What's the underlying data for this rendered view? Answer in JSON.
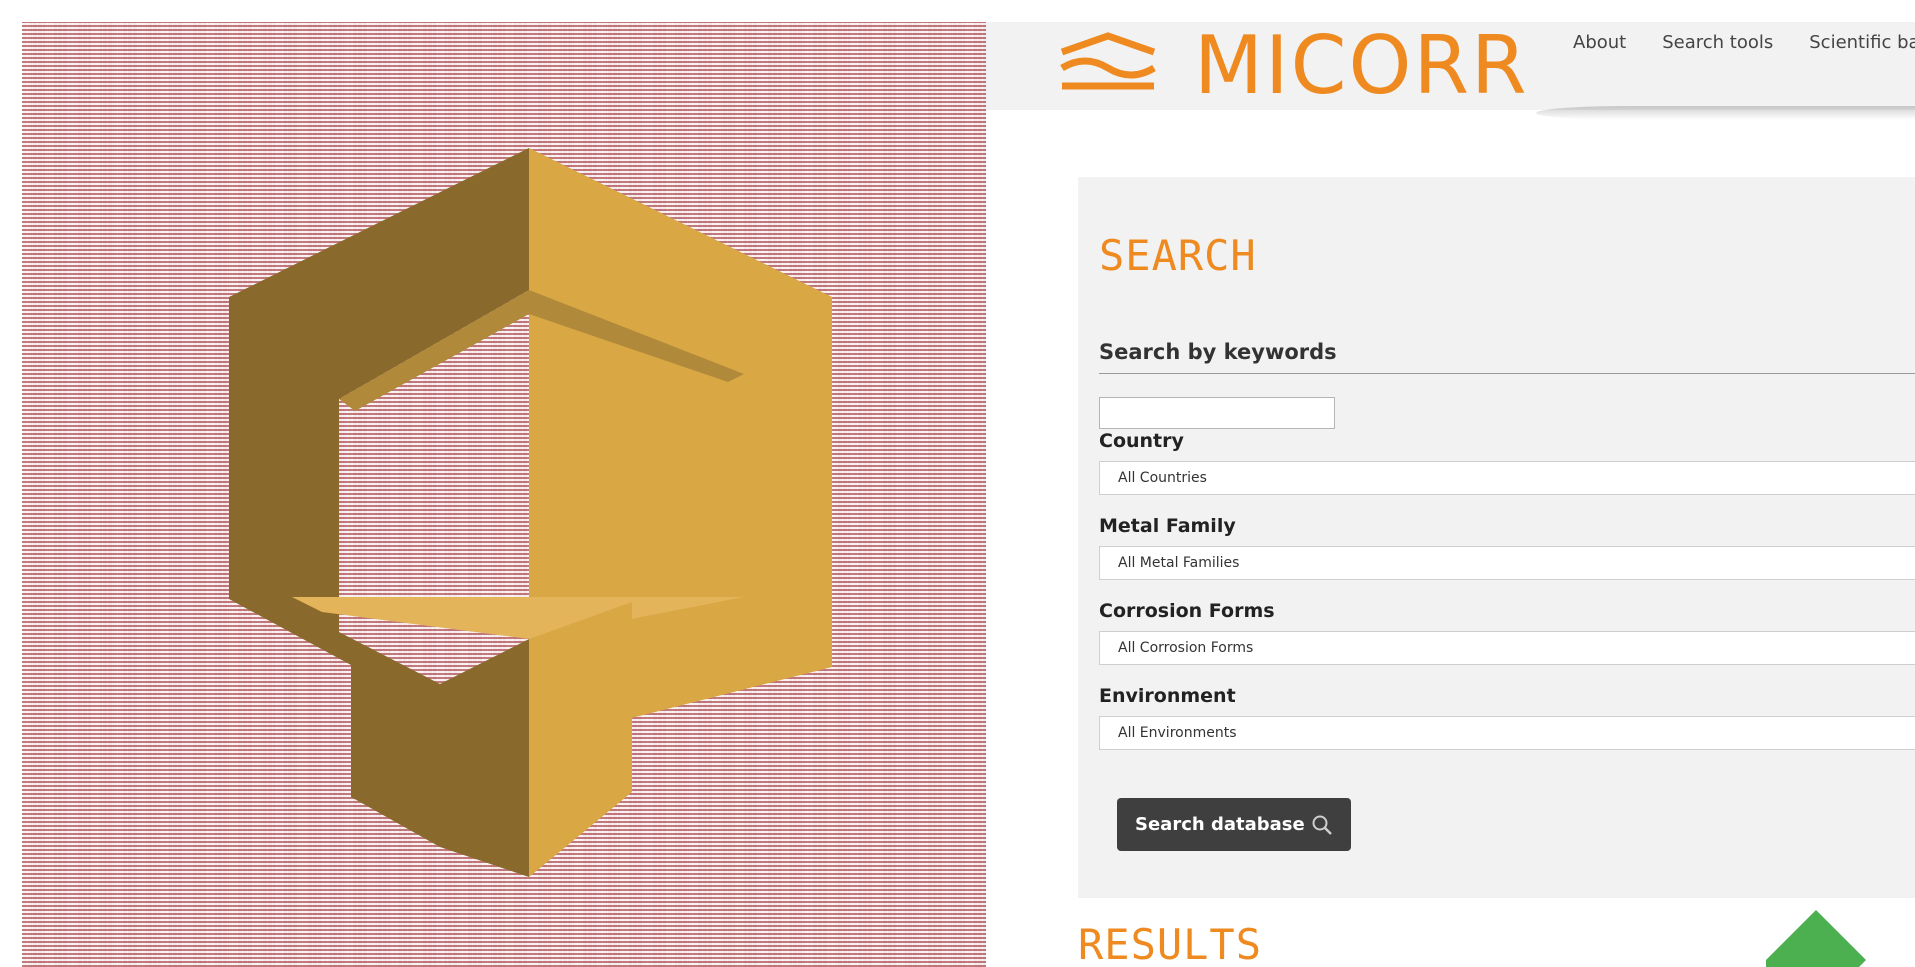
{
  "brand": {
    "name": "MICORR",
    "color": "#ee8a20"
  },
  "nav": [
    {
      "label": "About"
    },
    {
      "label": "Search tools"
    },
    {
      "label": "Scientific ba"
    }
  ],
  "search": {
    "title": "SEARCH",
    "keywords_label": "Search by keywords",
    "keywords_value": "",
    "keywords_placeholder": "",
    "fields": [
      {
        "label": "Country",
        "selected": "All Countries"
      },
      {
        "label": "Metal Family",
        "selected": "All Metal Families"
      },
      {
        "label": "Corrosion Forms",
        "selected": "All Corrosion Forms"
      },
      {
        "label": "Environment",
        "selected": "All Environments"
      }
    ],
    "button_label": "Search database"
  },
  "results": {
    "title": "RESULTS"
  },
  "colors": {
    "accent_orange": "#ee8a20",
    "logo_gold_light": "#d9a844",
    "logo_gold_dark": "#8a6a2c",
    "button_dark": "#3f3f3f",
    "scroll_green": "#4caf50",
    "noise_red": "#9a1420"
  },
  "icons": {
    "brand_mark": "wave-lines-icon",
    "search": "search-icon",
    "art": "gold-hexagon-logo",
    "scroll_top": "scroll-to-top-icon"
  }
}
